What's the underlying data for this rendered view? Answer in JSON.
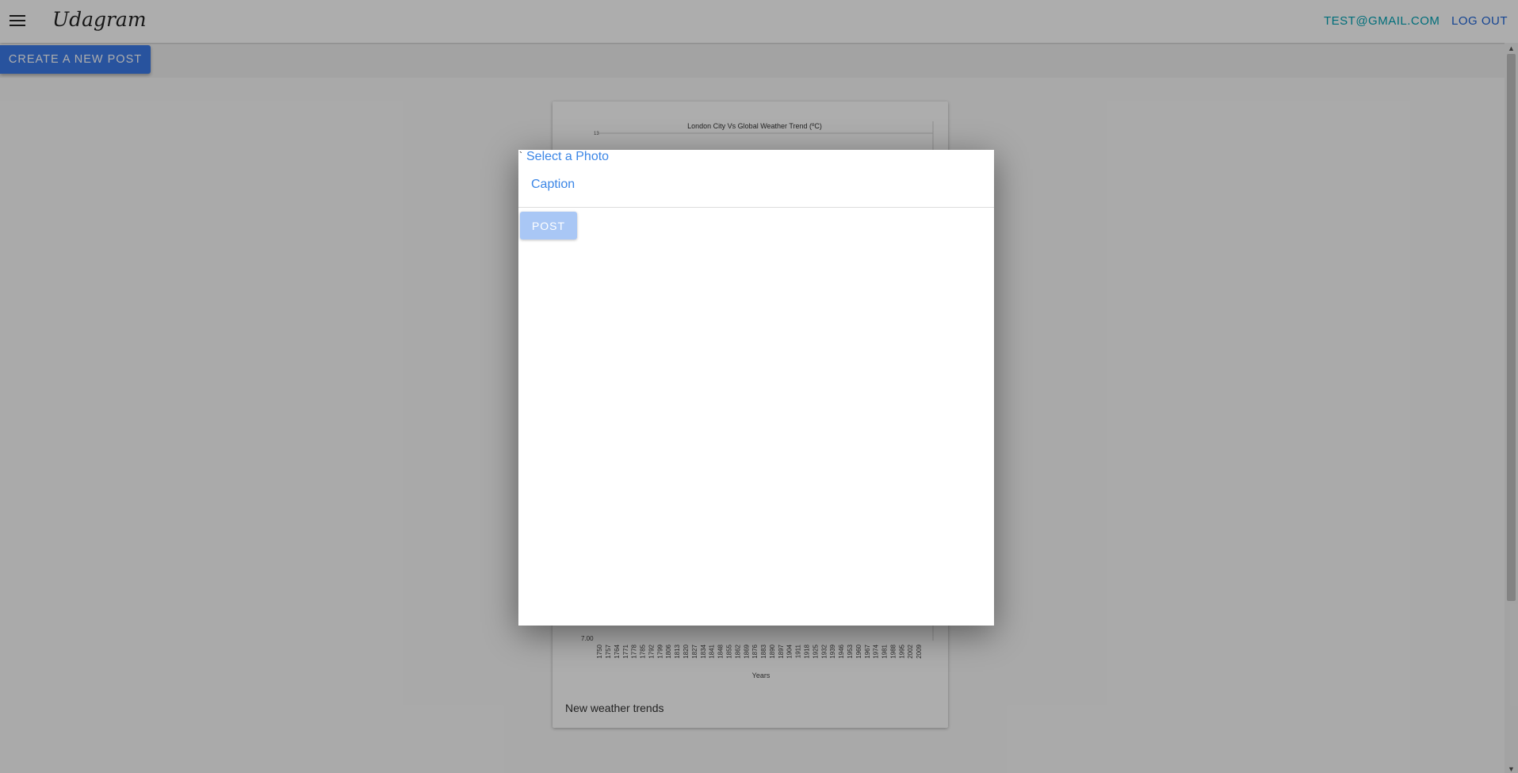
{
  "header": {
    "app_name": "Udagram",
    "menu_icon": "menu-icon",
    "user_email": "TEST@GMAIL.COM",
    "logout_label": "LOG OUT"
  },
  "toolbar": {
    "create_post_label": "CREATE A NEW POST"
  },
  "feed": {
    "posts": [
      {
        "caption": "New weather trends",
        "chart_data": {
          "type": "line",
          "title": "London City Vs Global Weather Trend (ºC)",
          "xlabel": "Years",
          "ylabel": "",
          "y_tick_labels_visible": [
            "13",
            "7.00"
          ],
          "x": [
            "1750",
            "1757",
            "1764",
            "1771",
            "1778",
            "1785",
            "1792",
            "1799",
            "1806",
            "1813",
            "1820",
            "1827",
            "1834",
            "1841",
            "1848",
            "1855",
            "1862",
            "1869",
            "1876",
            "1883",
            "1890",
            "1897",
            "1904",
            "1911",
            "1918",
            "1925",
            "1932",
            "1939",
            "1946",
            "1953",
            "1960",
            "1967",
            "1974",
            "1981",
            "1988",
            "1995",
            "2002",
            "2009"
          ]
        }
      }
    ]
  },
  "modal": {
    "tick_mark": "`",
    "select_photo_label": "Select a Photo",
    "caption_placeholder": "Caption",
    "post_label": "POST"
  }
}
